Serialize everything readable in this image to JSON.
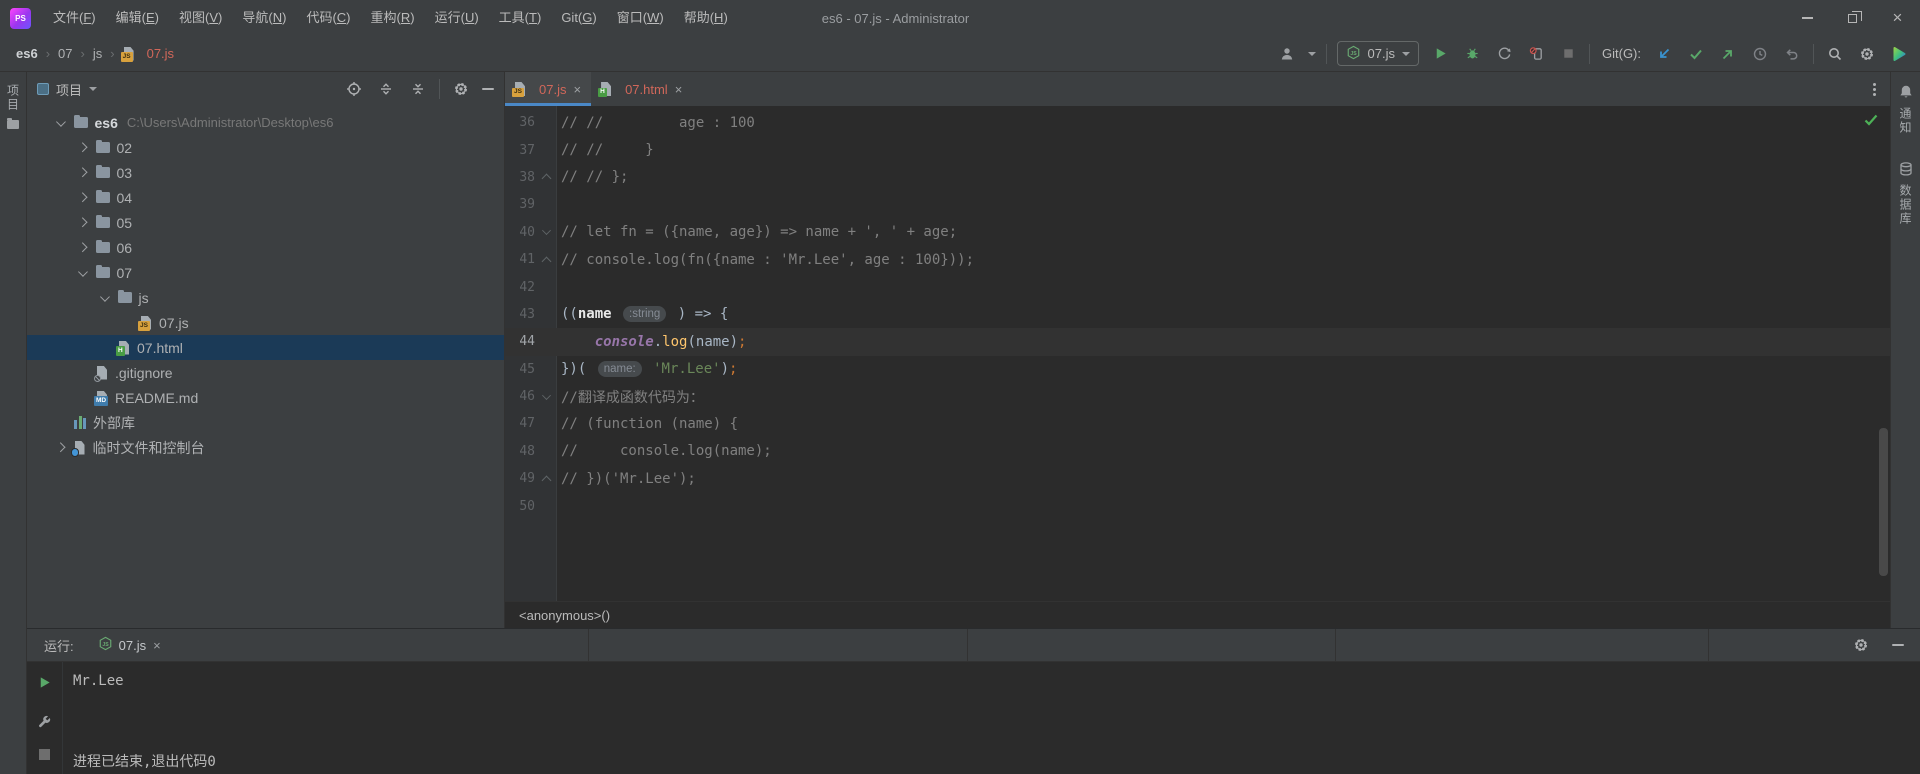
{
  "window": {
    "title": "es6 - 07.js - Administrator",
    "logo_text": "PS"
  },
  "menu": {
    "items": [
      "文件(F)",
      "编辑(E)",
      "视图(V)",
      "导航(N)",
      "代码(C)",
      "重构(R)",
      "运行(U)",
      "工具(T)",
      "Git(G)",
      "窗口(W)",
      "帮助(H)"
    ]
  },
  "breadcrumb": {
    "items": [
      {
        "label": "es6",
        "bold": true
      },
      {
        "label": "07"
      },
      {
        "label": "js"
      },
      {
        "label": "07.js",
        "file": "js",
        "color": "red"
      }
    ]
  },
  "toolbar": {
    "run_config": "07.js",
    "git_label": "Git(G):"
  },
  "stripes": {
    "left": {
      "label": "项目"
    },
    "right": [
      {
        "icon": "bell",
        "label": "通知"
      },
      {
        "icon": "database",
        "label": "数据库"
      }
    ]
  },
  "project_panel": {
    "title": "项目",
    "tree": [
      {
        "indent": 0,
        "chevron": "open",
        "icon": "folder",
        "label": "es6",
        "bold": true,
        "suffix": "C:\\Users\\Administrator\\Desktop\\es6"
      },
      {
        "indent": 1,
        "chevron": "closed",
        "icon": "folder",
        "label": "02"
      },
      {
        "indent": 1,
        "chevron": "closed",
        "icon": "folder",
        "label": "03"
      },
      {
        "indent": 1,
        "chevron": "closed",
        "icon": "folder",
        "label": "04"
      },
      {
        "indent": 1,
        "chevron": "closed",
        "icon": "folder",
        "label": "05"
      },
      {
        "indent": 1,
        "chevron": "closed",
        "icon": "folder",
        "label": "06"
      },
      {
        "indent": 1,
        "chevron": "open",
        "icon": "folder",
        "label": "07"
      },
      {
        "indent": 2,
        "chevron": "open",
        "icon": "folder",
        "label": "js"
      },
      {
        "indent": 3,
        "icon": "js",
        "label": "07.js",
        "color": "red"
      },
      {
        "indent": 2,
        "icon": "html",
        "label": "07.html",
        "color": "red",
        "selected": true
      },
      {
        "indent": 1,
        "icon": "gitignore",
        "label": ".gitignore"
      },
      {
        "indent": 1,
        "icon": "md",
        "label": "README.md"
      },
      {
        "indent": 0,
        "icon": "lib",
        "label": "外部库"
      },
      {
        "indent": 0,
        "chevron": "closed",
        "icon": "scratch",
        "label": "临时文件和控制台"
      }
    ]
  },
  "editor": {
    "tabs": [
      {
        "label": "07.js",
        "icon": "js",
        "active": true
      },
      {
        "label": "07.html",
        "icon": "html",
        "active": false
      }
    ],
    "breadcrumb": "<anonymous>()",
    "lines": [
      {
        "n": 36,
        "seg": [
          [
            "cmt",
            "// //         age : 100"
          ]
        ]
      },
      {
        "n": 37,
        "seg": [
          [
            "cmt",
            "// //     }"
          ]
        ]
      },
      {
        "n": 38,
        "fold": "up",
        "seg": [
          [
            "cmt",
            "// // };"
          ]
        ]
      },
      {
        "n": 39,
        "seg": []
      },
      {
        "n": 40,
        "fold": "down",
        "seg": [
          [
            "cmt",
            "// let fn = ({name, age}) => name + ', ' + age;"
          ]
        ]
      },
      {
        "n": 41,
        "fold": "up",
        "seg": [
          [
            "cmt",
            "// console.log(fn({name : 'Mr.Lee', age : 100}));"
          ]
        ]
      },
      {
        "n": 42,
        "seg": []
      },
      {
        "n": 43,
        "seg": [
          [
            "plain",
            "(("
          ],
          [
            "bold",
            "name "
          ],
          [
            "inlay",
            ":string"
          ],
          [
            "plain",
            " ) => {"
          ]
        ]
      },
      {
        "n": 44,
        "current": true,
        "seg": [
          [
            "plain",
            "    "
          ],
          [
            "global",
            "console"
          ],
          [
            "plain",
            "."
          ],
          [
            "fn",
            "log"
          ],
          [
            "plain",
            "(name)"
          ],
          [
            "semi",
            ";"
          ]
        ]
      },
      {
        "n": 45,
        "seg": [
          [
            "plain",
            "})( "
          ],
          [
            "inlay",
            "name:"
          ],
          [
            "plain",
            " "
          ],
          [
            "str",
            "'Mr.Lee'"
          ],
          [
            "plain",
            ")"
          ],
          [
            "semi",
            ";"
          ]
        ]
      },
      {
        "n": 46,
        "fold": "down",
        "seg": [
          [
            "cmt",
            "//翻译成函数代码为："
          ]
        ]
      },
      {
        "n": 47,
        "seg": [
          [
            "cmt",
            "// (function (name) {"
          ]
        ]
      },
      {
        "n": 48,
        "seg": [
          [
            "cmt",
            "//     console.log(name);"
          ]
        ]
      },
      {
        "n": 49,
        "fold": "up",
        "seg": [
          [
            "cmt",
            "// })('Mr.Lee');"
          ]
        ]
      },
      {
        "n": 50,
        "seg": []
      }
    ]
  },
  "run_panel": {
    "label": "运行:",
    "tab": "07.js",
    "output_lines": [
      "Mr.Lee",
      "",
      "",
      "进程已结束,退出代码0"
    ]
  },
  "colors": {
    "toolbar_bg": "#3c3f41",
    "editor_bg": "#2b2b2b",
    "accent_blue": "#4a88c7",
    "unversioned_red": "#d1675a",
    "selection_blue": "#1b3a57",
    "run_green": "#59a869",
    "string_green": "#6a8759",
    "comment_gray": "#808080",
    "semicolon_orange": "#cc7832",
    "function_yellow": "#ffc66d",
    "console_purple": "#9876aa"
  }
}
